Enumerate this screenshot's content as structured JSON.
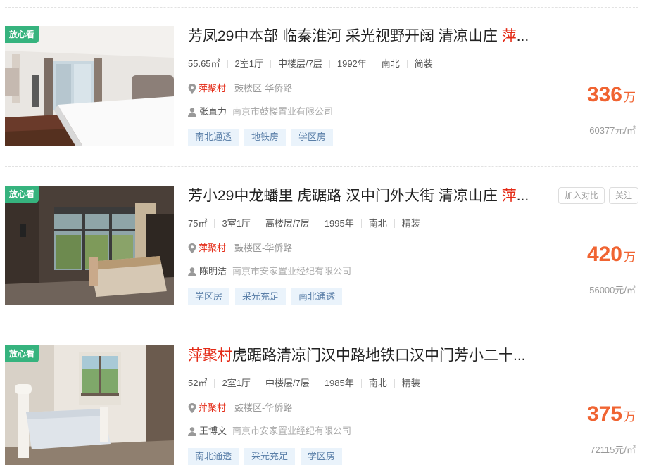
{
  "listings": [
    {
      "badge": "放心看",
      "title_text": "芳凤29中本部 临秦淮河 采光视野开阔 清凉山庄 ",
      "title_highlight": "萍",
      "title_ellipsis": "...",
      "show_actions": false,
      "attrs": [
        "55.65㎡",
        "2室1厅",
        "中楼层/7层",
        "1992年",
        "南北",
        "简装"
      ],
      "community": "萍聚村",
      "area": "鼓楼区-华侨路",
      "agent_name": "张直力",
      "agent_company": "南京市鼓楼置业有限公司",
      "tags": [
        "南北通透",
        "地铁房",
        "学区房"
      ],
      "price": "336",
      "price_unit": "万",
      "unit_price": "60377元/㎡"
    },
    {
      "badge": "放心看",
      "title_text": "芳小29中龙蟠里 虎踞路 汉中门外大街 清凉山庄 ",
      "title_highlight": "萍",
      "title_ellipsis": "...",
      "show_actions": true,
      "compare_label": "加入对比",
      "follow_label": "关注",
      "attrs": [
        "75㎡",
        "3室1厅",
        "高楼层/7层",
        "1995年",
        "南北",
        "精装"
      ],
      "community": "萍聚村",
      "area": "鼓楼区-华侨路",
      "agent_name": "陈明洁",
      "agent_company": "南京市安家置业经纪有限公司",
      "tags": [
        "学区房",
        "采光充足",
        "南北通透"
      ],
      "price": "420",
      "price_unit": "万",
      "unit_price": "56000元/㎡"
    },
    {
      "badge": "放心看",
      "title_highlight_first": "萍聚村",
      "title_text": "虎踞路清凉门汉中路地铁口汉中门芳小二十",
      "title_ellipsis": "...",
      "show_actions": false,
      "attrs": [
        "52㎡",
        "2室1厅",
        "中楼层/7层",
        "1985年",
        "南北",
        "精装"
      ],
      "community": "萍聚村",
      "area": "鼓楼区-华侨路",
      "agent_name": "王博文",
      "agent_company": "南京市安家置业经纪有限公司",
      "tags": [
        "南北通透",
        "采光充足",
        "学区房"
      ],
      "price": "375",
      "price_unit": "万",
      "unit_price": "72115元/㎡"
    }
  ],
  "colors": {
    "highlight": "#e42a16",
    "price": "#f06432",
    "badge": "#36b37e",
    "tag_bg": "#eaf3fb",
    "tag_text": "#5a7fa8"
  },
  "icons": {
    "location": "map-pin-icon",
    "agent": "user-icon"
  }
}
